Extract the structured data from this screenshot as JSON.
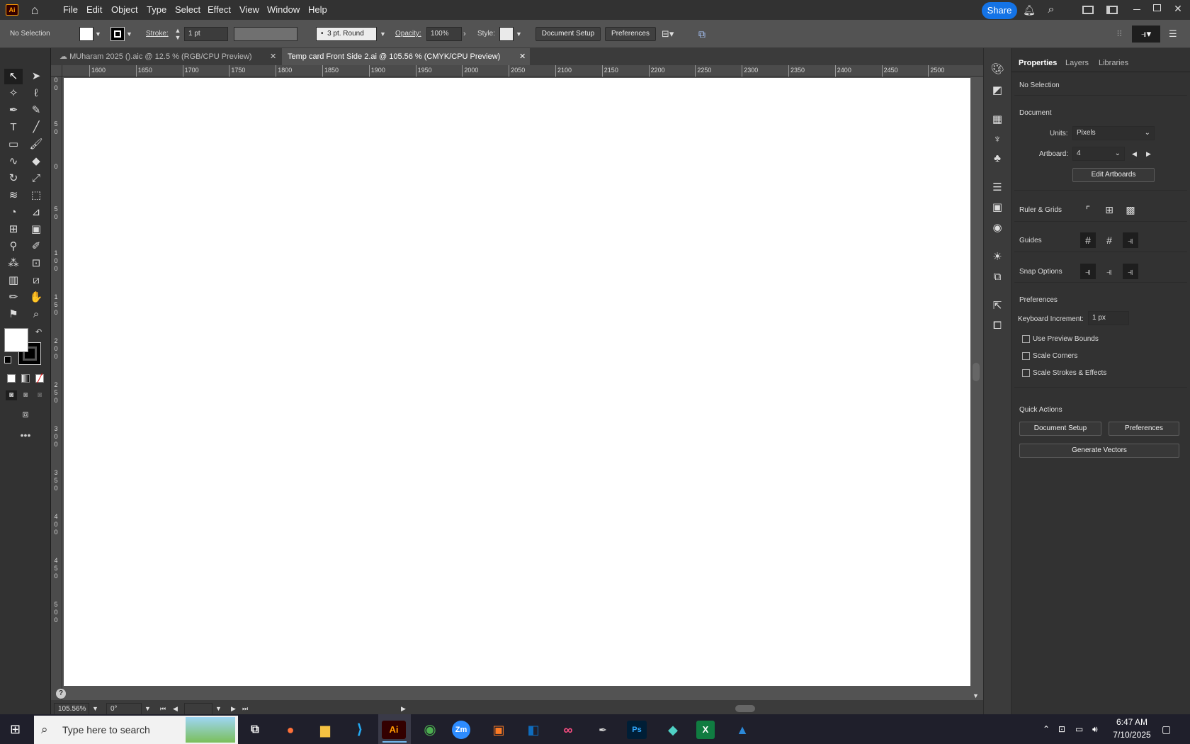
{
  "menubar": {
    "logo": "Ai",
    "items": [
      "File",
      "Edit",
      "Object",
      "Type",
      "Select",
      "Effect",
      "View",
      "Window",
      "Help"
    ],
    "share_label": "Share"
  },
  "control": {
    "selection": "No Selection",
    "stroke_label": "Stroke:",
    "stroke_value": "1 pt",
    "brush_value": "3 pt. Round",
    "opacity_label": "Opacity:",
    "opacity_value": "100%",
    "style_label": "Style:",
    "document_setup": "Document Setup",
    "preferences": "Preferences"
  },
  "tabs": [
    {
      "title": "MUharam 2025 ().aic @ 12.5 % (RGB/CPU Preview)",
      "active": false
    },
    {
      "title": "Temp  card Front Side 2.ai @ 105.56 % (CMYK/CPU Preview)",
      "active": true
    }
  ],
  "ruler": {
    "top": [
      "1600",
      "1650",
      "1700",
      "1750",
      "1800",
      "1850",
      "1900",
      "1950",
      "2000",
      "2050",
      "2100",
      "2150",
      "2200",
      "2250",
      "2300",
      "2350",
      "2400",
      "2450",
      "2500"
    ],
    "left": [
      "0\n0",
      "5\n0",
      "0",
      "5\n0",
      "1\n0\n0",
      "1\n5\n0",
      "2\n0\n0",
      "2\n5\n0",
      "3\n0\n0",
      "3\n5\n0",
      "4\n0\n0",
      "4\n5\n0",
      "5\n0\n0"
    ]
  },
  "status": {
    "zoom": "105.56%",
    "rotation": "0°",
    "help": "?"
  },
  "properties": {
    "tabs": [
      "Properties",
      "Layers",
      "Libraries"
    ],
    "selection": "No Selection",
    "document_heading": "Document",
    "units_label": "Units:",
    "units_value": "Pixels",
    "artboard_label": "Artboard:",
    "artboard_value": "4",
    "edit_artboards": "Edit Artboards",
    "ruler_grids": "Ruler & Grids",
    "guides": "Guides",
    "snap_options": "Snap Options",
    "preferences_heading": "Preferences",
    "keyboard_increment_label": "Keyboard Increment:",
    "keyboard_increment_value": "1 px",
    "use_preview_bounds": "Use Preview Bounds",
    "scale_corners": "Scale Corners",
    "scale_strokes": "Scale Strokes & Effects",
    "quick_actions": "Quick Actions",
    "qa_document_setup": "Document Setup",
    "qa_preferences": "Preferences",
    "qa_generate_vectors": "Generate Vectors"
  },
  "taskbar": {
    "search_placeholder": "Type here to search",
    "time": "6:47 AM",
    "date": "7/10/2025",
    "apps": [
      "Ai",
      "Zm",
      "Ps",
      "X"
    ]
  }
}
